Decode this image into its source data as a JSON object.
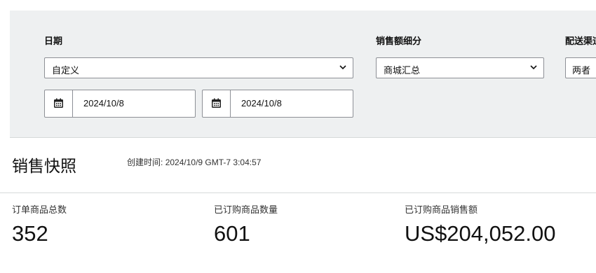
{
  "filters": {
    "date": {
      "label": "日期",
      "range_select": "自定义",
      "start_date": "2024/10/8",
      "end_date": "2024/10/8"
    },
    "sales_breakdown": {
      "label": "销售额细分",
      "select": "商城汇总"
    },
    "fulfillment": {
      "label": "配送渠道",
      "select": "两者"
    }
  },
  "snapshot": {
    "title": "销售快照",
    "created_label": "创建时间:",
    "created_value": "2024/10/9 GMT-7 3:04:57"
  },
  "metrics": [
    {
      "label": "订单商品总数",
      "value": "352"
    },
    {
      "label": "已订购商品数量",
      "value": "601"
    },
    {
      "label": "已订购商品销售额",
      "value": "US$204,052.00"
    }
  ],
  "icons": {
    "calendar": "calendar-icon",
    "dropdown": "chevron-down-icon"
  },
  "colors": {
    "panel_bg": "#eef0f1",
    "border": "#8d9096",
    "text": "#111111"
  }
}
